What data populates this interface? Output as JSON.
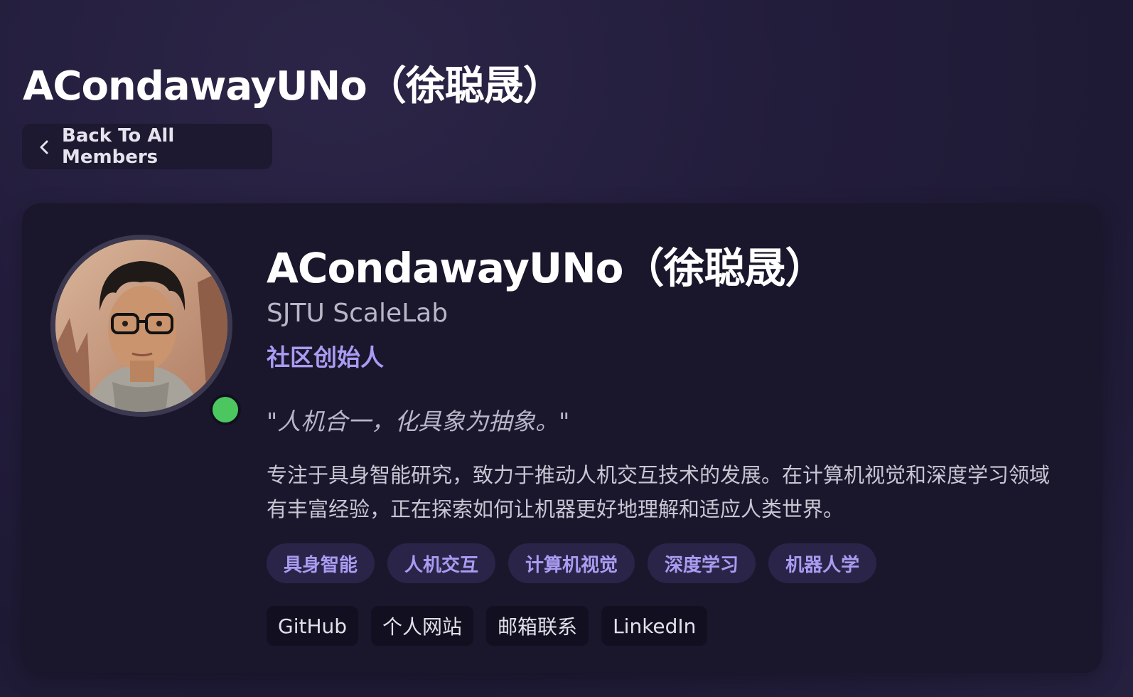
{
  "page": {
    "title": "ACondawayUNo（徐聪晟）"
  },
  "back_button": {
    "label": "Back To All Members"
  },
  "profile": {
    "name": "ACondawayUNo（徐聪晟）",
    "organization": "SJTU ScaleLab",
    "role": "社区创始人",
    "quote": "\"人机合一，化具象为抽象。\"",
    "bio": "专注于具身智能研究，致力于推动人机交互技术的发展。在计算机视觉和深度学习领域有丰富经验，正在探索如何让机器更好地理解和适应人类世界。",
    "status_color": "#4cc760",
    "accent_color": "#a99cf2",
    "tags": [
      {
        "label": "具身智能"
      },
      {
        "label": "人机交互"
      },
      {
        "label": "计算机视觉"
      },
      {
        "label": "深度学习"
      },
      {
        "label": "机器人学"
      }
    ],
    "links": [
      {
        "label": "GitHub"
      },
      {
        "label": "个人网站"
      },
      {
        "label": "邮箱联系"
      },
      {
        "label": "LinkedIn"
      }
    ]
  }
}
